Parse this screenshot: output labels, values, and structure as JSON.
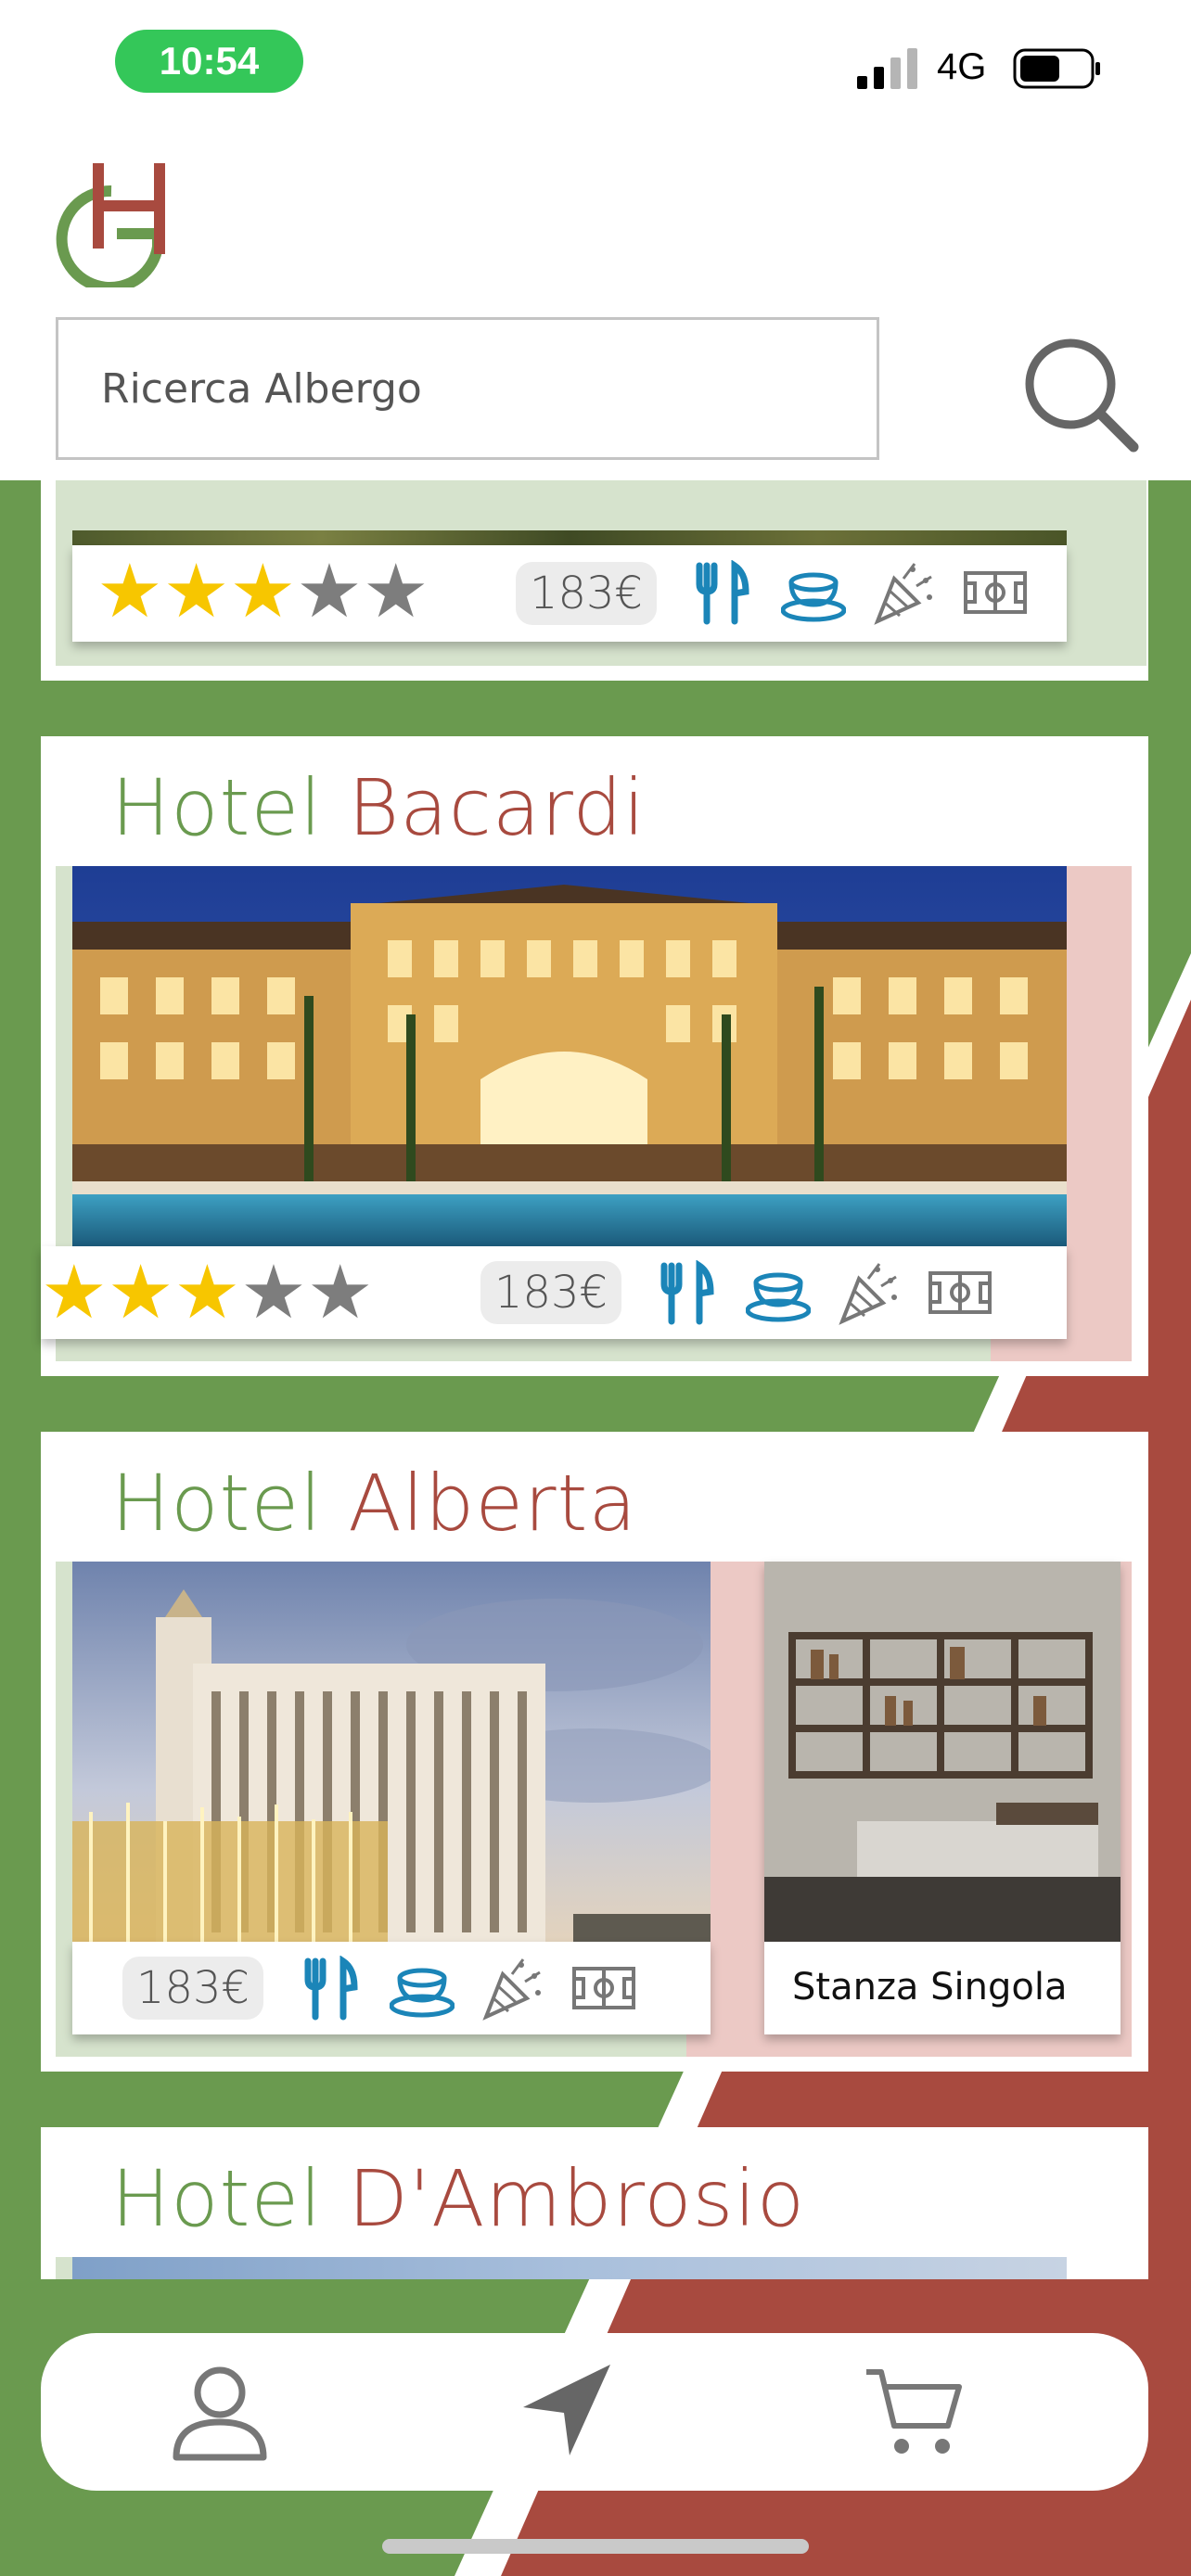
{
  "status_bar": {
    "time": "10:54",
    "network": "4G"
  },
  "app": {
    "logo_letters": "GH"
  },
  "search": {
    "placeholder": "Ricerca Albergo",
    "value": ""
  },
  "colors": {
    "brand_green": "#6a9a4f",
    "brand_red": "#a84a3f",
    "amenity_blue": "#1b85b8",
    "star_yellow": "#f7c600",
    "star_grey": "#7d7d7d"
  },
  "hotels": [
    {
      "name_first": "",
      "name_second": "",
      "rating": 3,
      "max_rating": 5,
      "price": "183€",
      "amenities": [
        "restaurant-icon",
        "breakfast-icon",
        "party-icon",
        "football-field-icon"
      ]
    },
    {
      "name_first": "Hotel",
      "name_second": "Bacardi",
      "rating": 3,
      "max_rating": 5,
      "price": "183€",
      "amenities": [
        "restaurant-icon",
        "breakfast-icon",
        "party-icon",
        "football-field-icon"
      ]
    },
    {
      "name_first": "Hotel",
      "name_second": "Alberta",
      "price": "183€",
      "amenities": [
        "restaurant-icon",
        "breakfast-icon",
        "party-icon",
        "football-field-icon"
      ],
      "room": {
        "label": "Stanza Singola"
      }
    },
    {
      "name_first": "Hotel",
      "name_second": "D'Ambrosio"
    }
  ],
  "bottom_nav": {
    "items": [
      {
        "icon": "user-icon"
      },
      {
        "icon": "navigation-icon"
      },
      {
        "icon": "cart-icon"
      }
    ]
  }
}
